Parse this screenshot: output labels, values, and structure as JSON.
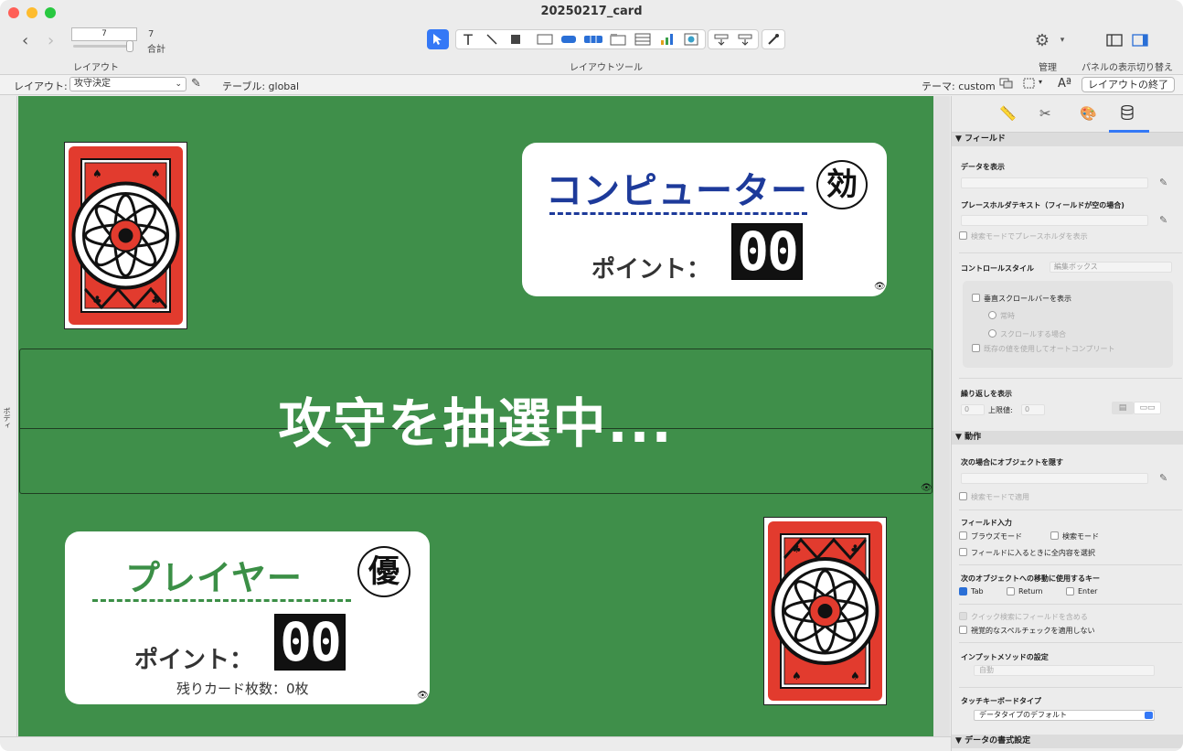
{
  "window": {
    "title": "20250217_card"
  },
  "toolbar": {
    "record_value": "7",
    "record_total": "7",
    "total_label": "合計",
    "layout_label": "レイアウト",
    "tools_label": "レイアウトツール",
    "manage_label": "管理",
    "panel_toggle_label": "パネルの表示切り替え"
  },
  "layoutbar": {
    "layout_prefix": "レイアウト:",
    "layout_value": "攻守決定",
    "table_label": "テーブル: global",
    "theme_label": "テーマ: custom",
    "exit_button": "レイアウトの終了"
  },
  "leftstrip": {
    "label": "ボディ"
  },
  "canvas": {
    "computer_title": "コンピューター",
    "computer_badge": "効",
    "computer_points_label": "ポイント：",
    "computer_points": "00",
    "banner_text": "攻守を抽選中...",
    "player_title": "プレイヤー",
    "player_badge": "優",
    "player_points_label": "ポイント：",
    "player_points": "00",
    "remaining_cards": "残りカード枚数：0枚",
    "colors": {
      "background": "#3f8f4a",
      "computer": "#1d3a9a",
      "player": "#3b8f46",
      "card_red": "#e23b2e"
    }
  },
  "inspector": {
    "section_field": "フィールド",
    "show_data": "データを表示",
    "placeholder_text": "プレースホルダテキスト（フィールドが空の場合)",
    "show_placeholder_find": "検索モードでプレースホルダを表示",
    "control_style": "コントロールスタイル",
    "control_style_value": "編集ボックス",
    "vertical_scrollbar": "垂直スクロールバーを表示",
    "always": "常時",
    "when_scrolling": "スクロールする場合",
    "autocomplete": "既存の値を使用してオートコンプリート",
    "show_repetitions": "繰り返しを表示",
    "rep_from": "0",
    "upper_limit": "上限値:",
    "rep_to": "0",
    "section_behavior": "動作",
    "hide_object_when": "次の場合にオブジェクトを隠す",
    "apply_in_find": "検索モードで適用",
    "field_entry": "フィールド入力",
    "browse_mode": "ブラウズモード",
    "find_mode": "検索モード",
    "select_all_on_entry": "フィールドに入るときに全内容を選択",
    "nav_keys": "次のオブジェクトへの移動に使用するキー",
    "key_tab": "Tab",
    "key_return": "Return",
    "key_enter": "Enter",
    "quick_find": "クイック検索にフィールドを含める",
    "no_spellcheck": "視覚的なスペルチェックを適用しない",
    "input_method": "インプットメソッドの設定",
    "input_method_value": "自動",
    "touch_keyboard": "タッチキーボードタイプ",
    "touch_keyboard_value": "データタイプのデフォルト",
    "section_format": "データの書式設定"
  }
}
